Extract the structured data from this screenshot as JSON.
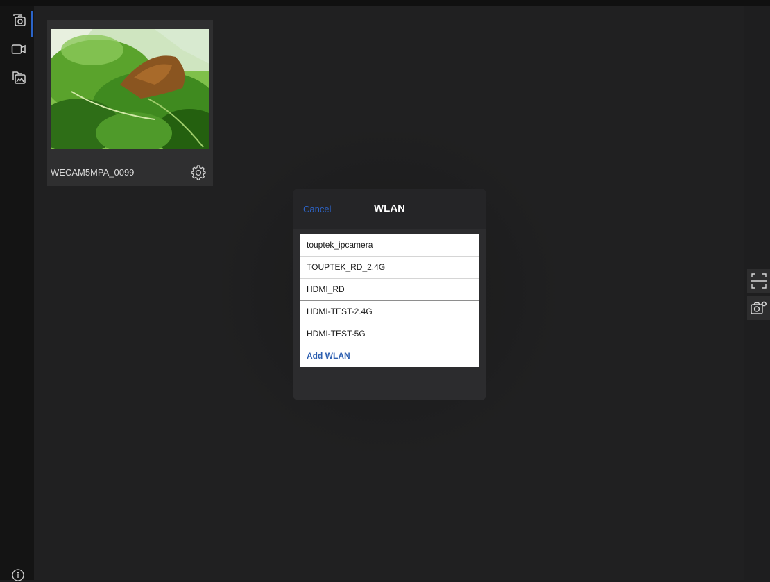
{
  "sidebar": {
    "items": [
      {
        "icon": "camera-gallery-icon",
        "active": true
      },
      {
        "icon": "video-camera-icon",
        "active": false
      },
      {
        "icon": "image-folder-icon",
        "active": false
      }
    ],
    "info_icon": "info-icon"
  },
  "camera_card": {
    "name": "WECAM5MPA_0099",
    "settings_icon": "gear-icon"
  },
  "dialog": {
    "cancel_label": "Cancel",
    "title": "WLAN",
    "networks": [
      "touptek_ipcamera",
      "TOUPTEK_RD_2.4G",
      "HDMI_RD",
      "HDMI-TEST-2.4G",
      "HDMI-TEST-5G"
    ],
    "add_label": "Add WLAN"
  },
  "right_toolbar": {
    "items": [
      "scan-icon",
      "camera-settings-icon"
    ]
  },
  "colors": {
    "accent": "#2d63c6",
    "background": "#202021",
    "sidebar": "#141414",
    "dialog": "#2c2c2e"
  }
}
